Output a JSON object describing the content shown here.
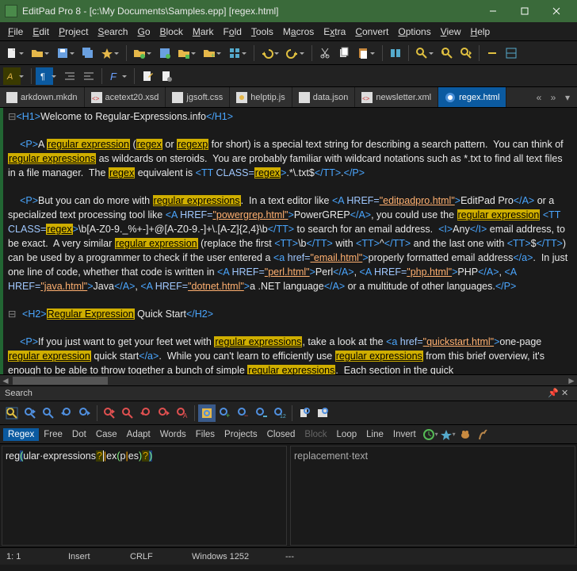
{
  "window": {
    "title": "EditPad Pro 8 - [c:\\My Documents\\Samples.epp] [regex.html]"
  },
  "menu": [
    "File",
    "Edit",
    "Project",
    "Search",
    "Go",
    "Block",
    "Mark",
    "Fold",
    "Tools",
    "Macros",
    "Extra",
    "Convert",
    "Options",
    "View",
    "Help"
  ],
  "tabs": {
    "items": [
      {
        "label": "arkdown.mkdn",
        "color": "#cccccc"
      },
      {
        "label": "acetext20.xsd",
        "color": "#6aa0ff"
      },
      {
        "label": "jgsoft.css",
        "color": "#cccccc"
      },
      {
        "label": "helptip.js",
        "color": "#e6c04a"
      },
      {
        "label": "data.json",
        "color": "#cccccc"
      },
      {
        "label": "newsletter.xml",
        "color": "#6aa0ff"
      },
      {
        "label": "regex.html",
        "color": "#6aa0ff"
      }
    ],
    "activeIndex": 6
  },
  "search": {
    "title": "Search",
    "options": [
      "Regex",
      "Free",
      "Dot",
      "Case",
      "Adapt",
      "Words",
      "Files",
      "Projects",
      "Closed",
      "Block",
      "Loop",
      "Line",
      "Invert"
    ],
    "active": [
      0
    ],
    "disabled": [
      9
    ],
    "find": "reg(ular·expressions?|ex(p|es)?)",
    "replace": "replacement·text"
  },
  "status": {
    "pos": "1: 1",
    "mode": "Insert",
    "eol": "CRLF",
    "enc": "Windows 1252",
    "extra": "---"
  },
  "icons": {
    "new": "new-file",
    "open": "open-folder",
    "save": "save",
    "saveall": "save-all",
    "print": "print",
    "cut": "cut",
    "copy": "copy",
    "paste": "paste",
    "undo": "undo",
    "redo": "redo",
    "find": "find",
    "findnext": "find-next"
  }
}
